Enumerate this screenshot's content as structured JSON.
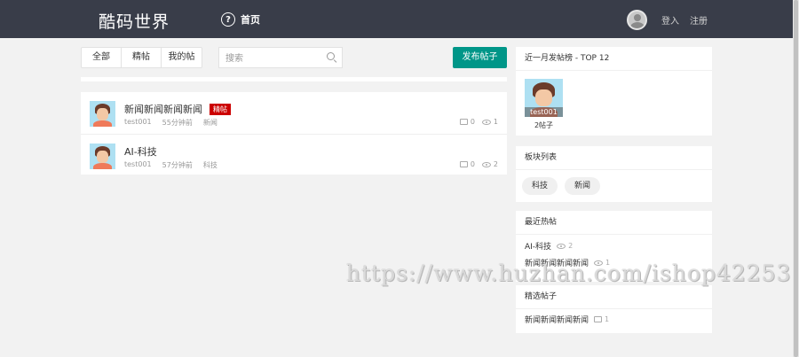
{
  "header": {
    "logo": "酷码世界",
    "home_label": "首页",
    "login_label": "登入",
    "register_label": "注册"
  },
  "filters": {
    "tabs": [
      "全部",
      "精帖",
      "我的帖"
    ],
    "search_placeholder": "搜索",
    "post_button": "发布帖子"
  },
  "posts": [
    {
      "title": "新闻新闻新闻新闻",
      "badge": "精帖",
      "author": "test001",
      "time": "55分钟前",
      "category": "新闻",
      "comments": "0",
      "views": "1"
    },
    {
      "title": "AI-科技",
      "badge": "",
      "author": "test001",
      "time": "57分钟前",
      "category": "科技",
      "comments": "0",
      "views": "2"
    }
  ],
  "top_posters": {
    "title": "近一月发帖榜 - TOP 12",
    "users": [
      {
        "name": "test001",
        "count": "2帖子"
      }
    ]
  },
  "boards": {
    "title": "板块列表",
    "items": [
      "科技",
      "新闻"
    ]
  },
  "recent_hot": {
    "title": "最近热帖",
    "items": [
      {
        "title": "AI-科技",
        "views": "2"
      },
      {
        "title": "新闻新闻新闻新闻",
        "views": "1"
      }
    ]
  },
  "featured": {
    "title": "精选帖子",
    "items": [
      {
        "title": "新闻新闻新闻新闻",
        "comments": "1"
      }
    ]
  },
  "watermark": "https://www.huzhan.com/ishop42253",
  "colors": {
    "header_bg": "#393d49",
    "accent": "#009688",
    "badge": "#cc0000"
  }
}
